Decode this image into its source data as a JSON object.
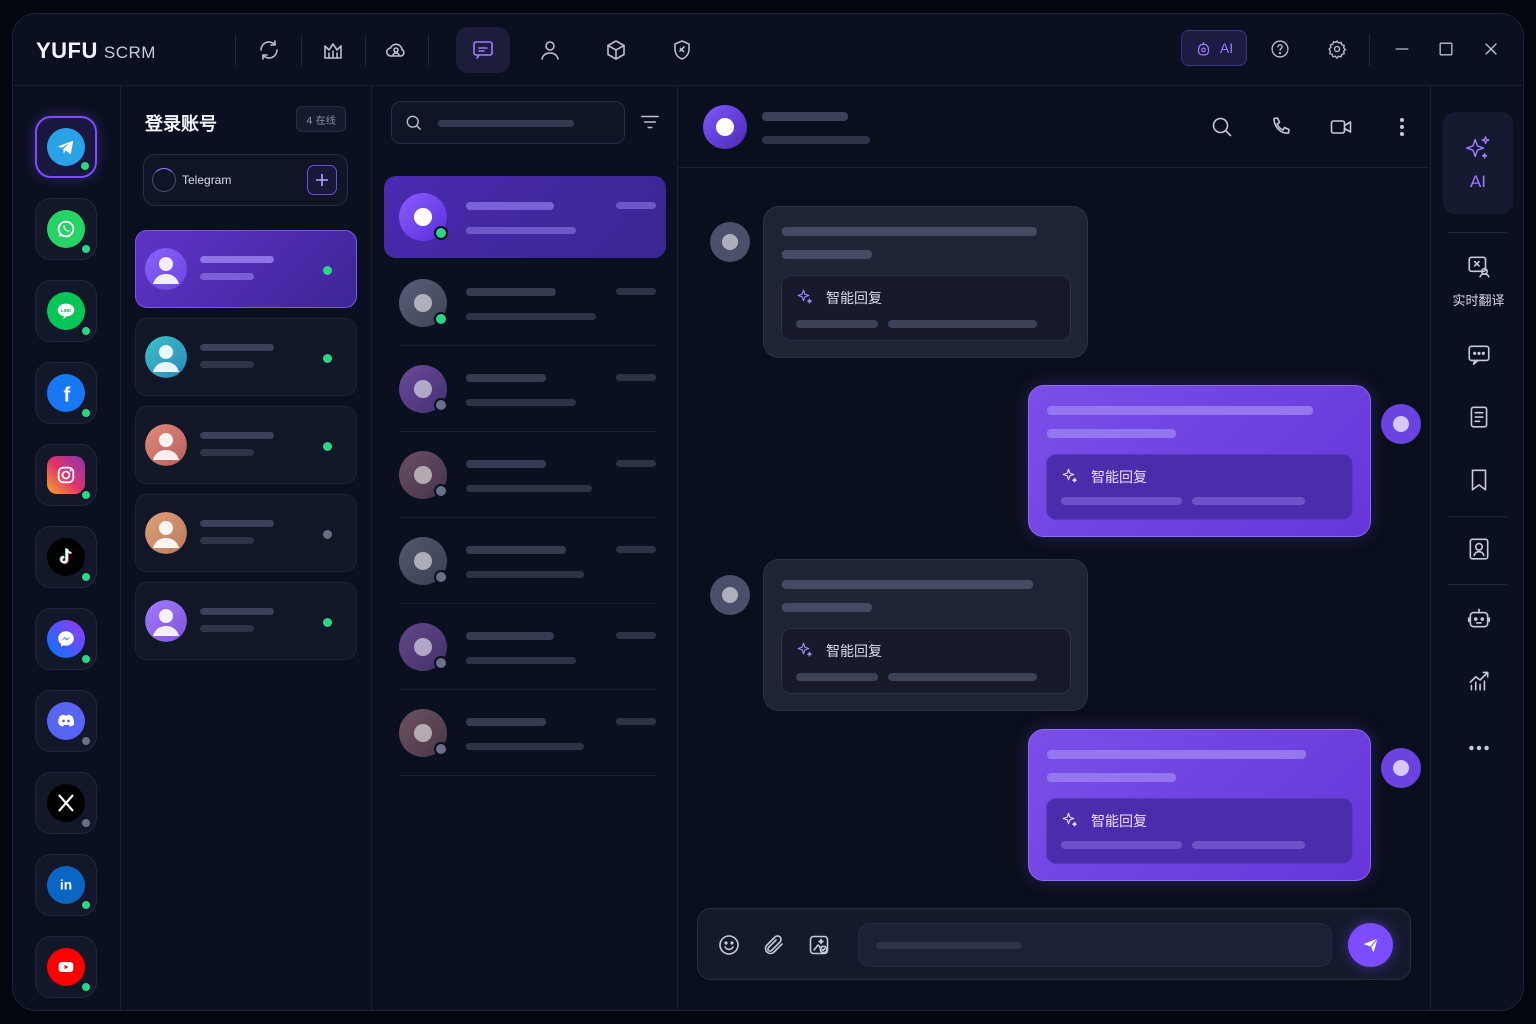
{
  "app": {
    "brand": "YUFU",
    "brand_suffix": "SCRM"
  },
  "toolbar": {
    "icons": [
      "sync-icon",
      "analytics-icon",
      "contacts-cloud-icon",
      "chat-icon",
      "user-icon",
      "cube-icon",
      "shield-icon"
    ],
    "active": "chat-icon",
    "ai_label": "AI"
  },
  "platforms": [
    {
      "name": "Telegram",
      "icon": "telegram-icon",
      "online": true,
      "active": true
    },
    {
      "name": "WhatsApp",
      "icon": "whatsapp-icon",
      "online": true
    },
    {
      "name": "LINE",
      "icon": "line-icon",
      "online": true,
      "badge_text": "LINE"
    },
    {
      "name": "Facebook",
      "icon": "facebook-icon",
      "online": true,
      "badge_text": "f"
    },
    {
      "name": "Instagram",
      "icon": "instagram-icon",
      "online": true
    },
    {
      "name": "TikTok",
      "icon": "tiktok-icon",
      "online": true
    },
    {
      "name": "Messenger",
      "icon": "messenger-icon",
      "online": true
    },
    {
      "name": "Discord",
      "icon": "discord-icon",
      "online": false
    },
    {
      "name": "X",
      "icon": "x-icon",
      "online": false
    },
    {
      "name": "LinkedIn",
      "icon": "linkedin-icon",
      "online": true,
      "badge_text": "in"
    },
    {
      "name": "YouTube",
      "icon": "youtube-icon",
      "online": true
    }
  ],
  "accounts": {
    "title": "登录账号",
    "online_badge": "4 在线",
    "selector_label": "Telegram",
    "items": [
      {
        "online": true,
        "active": true
      },
      {
        "online": true
      },
      {
        "online": true
      },
      {
        "online": false
      },
      {
        "online": true
      }
    ]
  },
  "conversations": {
    "search_placeholder": "",
    "items": [
      {
        "online": true,
        "active": true
      },
      {
        "online": true
      },
      {
        "online": false
      },
      {
        "online": false
      },
      {
        "online": false
      },
      {
        "online": false
      },
      {
        "online": false
      }
    ]
  },
  "chat": {
    "header_icons": [
      "search-icon",
      "phone-icon",
      "video-icon",
      "more-vertical-icon"
    ],
    "messages": [
      {
        "direction": "in",
        "smart_reply_label": "智能回复"
      },
      {
        "direction": "out",
        "smart_reply_label": "智能回复"
      },
      {
        "direction": "in",
        "smart_reply_label": "智能回复"
      },
      {
        "direction": "out",
        "smart_reply_label": "智能回复"
      }
    ],
    "composer_placeholder": ""
  },
  "tools": {
    "ai_label": "AI",
    "items": [
      {
        "icon": "translate-icon",
        "label": "实时翻译"
      },
      {
        "icon": "quick-reply-icon"
      },
      {
        "icon": "notes-icon"
      },
      {
        "icon": "bookmark-icon"
      },
      {
        "icon": "contact-card-icon"
      },
      {
        "icon": "bot-icon"
      },
      {
        "icon": "stats-icon"
      },
      {
        "icon": "more-horizontal-icon"
      }
    ]
  },
  "colors": {
    "accent": "#7c4dff",
    "online": "#2bd68b",
    "offline": "#6a7087",
    "background": "#0b1020"
  }
}
